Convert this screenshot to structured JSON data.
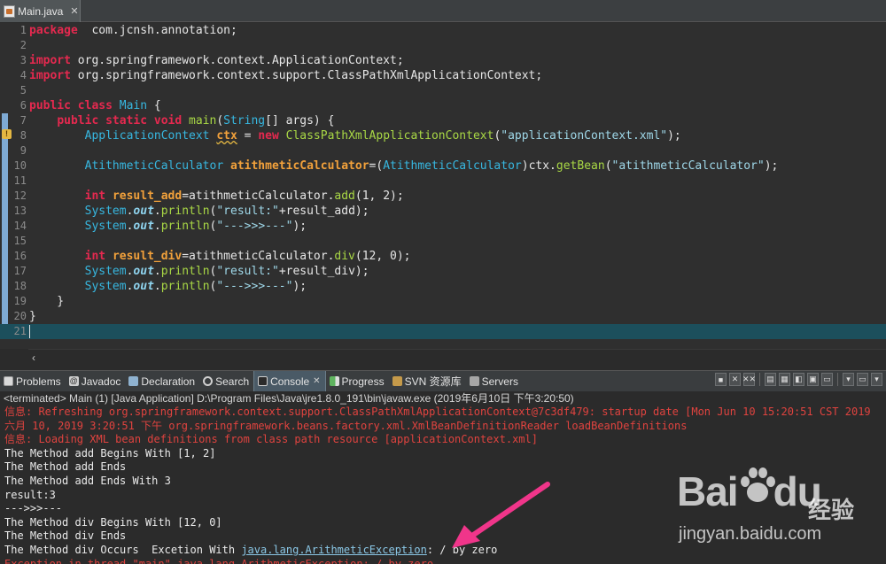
{
  "editor_tab": {
    "label": "Main.java",
    "close": "✕"
  },
  "code_lines": [
    {
      "num": "1",
      "tokens": [
        [
          "kw",
          "package"
        ],
        [
          "",
          "  com.jcnsh.annotation;"
        ]
      ]
    },
    {
      "num": "2",
      "tokens": []
    },
    {
      "num": "3",
      "tokens": [
        [
          "kw",
          "import"
        ],
        [
          "",
          " org.springframework.context.ApplicationContext;"
        ]
      ]
    },
    {
      "num": "4",
      "tokens": [
        [
          "kw",
          "import"
        ],
        [
          "",
          " org.springframework.context.support.ClassPathXmlApplicationContext;"
        ]
      ]
    },
    {
      "num": "5",
      "tokens": []
    },
    {
      "num": "6",
      "tokens": [
        [
          "kw",
          "public class"
        ],
        [
          "",
          " "
        ],
        [
          "ty",
          "Main"
        ],
        [
          "",
          " {"
        ]
      ]
    },
    {
      "num": "7",
      "tokens": [
        [
          "",
          "    "
        ],
        [
          "kw",
          "public static void"
        ],
        [
          "",
          " "
        ],
        [
          "fn",
          "main"
        ],
        [
          "",
          "("
        ],
        [
          "ty",
          "String"
        ],
        [
          "",
          "[] args) {"
        ]
      ]
    },
    {
      "num": "8",
      "tokens": [
        [
          "",
          "        "
        ],
        [
          "ty",
          "ApplicationContext"
        ],
        [
          "",
          " "
        ],
        [
          "var warn-underline",
          "ctx"
        ],
        [
          "",
          " = "
        ],
        [
          "kw",
          "new"
        ],
        [
          "",
          " "
        ],
        [
          "fn",
          "ClassPathXmlApplicationContext"
        ],
        [
          "",
          "("
        ],
        [
          "str",
          "\"applicationContext.xml\""
        ],
        [
          "",
          ");"
        ]
      ]
    },
    {
      "num": "9",
      "tokens": []
    },
    {
      "num": "10",
      "tokens": [
        [
          "",
          "        "
        ],
        [
          "ty",
          "AtithmeticCalculator"
        ],
        [
          "",
          " "
        ],
        [
          "var",
          "atithmeticCalculator"
        ],
        [
          "",
          "=("
        ],
        [
          "ty",
          "AtithmeticCalculator"
        ],
        [
          "",
          ")ctx."
        ],
        [
          "fn",
          "getBean"
        ],
        [
          "",
          "("
        ],
        [
          "str",
          "\"atithmeticCalculator\""
        ],
        [
          "",
          ");"
        ]
      ]
    },
    {
      "num": "11",
      "tokens": []
    },
    {
      "num": "12",
      "tokens": [
        [
          "",
          "        "
        ],
        [
          "kw",
          "int"
        ],
        [
          "",
          " "
        ],
        [
          "var",
          "result_add"
        ],
        [
          "",
          "=atithmeticCalculator."
        ],
        [
          "fn",
          "add"
        ],
        [
          "",
          "(1, 2);"
        ]
      ]
    },
    {
      "num": "13",
      "tokens": [
        [
          "",
          "        "
        ],
        [
          "ty",
          "System"
        ],
        [
          "",
          "."
        ],
        [
          "static",
          "out"
        ],
        [
          "",
          "."
        ],
        [
          "fn",
          "println"
        ],
        [
          "",
          "("
        ],
        [
          "str",
          "\"result:\""
        ],
        [
          "",
          "+result_add);"
        ]
      ]
    },
    {
      "num": "14",
      "tokens": [
        [
          "",
          "        "
        ],
        [
          "ty",
          "System"
        ],
        [
          "",
          "."
        ],
        [
          "static",
          "out"
        ],
        [
          "",
          "."
        ],
        [
          "fn",
          "println"
        ],
        [
          "",
          "("
        ],
        [
          "str",
          "\"--->>>---\""
        ],
        [
          "",
          ");"
        ]
      ]
    },
    {
      "num": "15",
      "tokens": []
    },
    {
      "num": "16",
      "tokens": [
        [
          "",
          "        "
        ],
        [
          "kw",
          "int"
        ],
        [
          "",
          " "
        ],
        [
          "var",
          "result_div"
        ],
        [
          "",
          "=atithmeticCalculator."
        ],
        [
          "fn",
          "div"
        ],
        [
          "",
          "(12, 0);"
        ]
      ]
    },
    {
      "num": "17",
      "tokens": [
        [
          "",
          "        "
        ],
        [
          "ty",
          "System"
        ],
        [
          "",
          "."
        ],
        [
          "static",
          "out"
        ],
        [
          "",
          "."
        ],
        [
          "fn",
          "println"
        ],
        [
          "",
          "("
        ],
        [
          "str",
          "\"result:\""
        ],
        [
          "",
          "+result_div);"
        ]
      ]
    },
    {
      "num": "18",
      "tokens": [
        [
          "",
          "        "
        ],
        [
          "ty",
          "System"
        ],
        [
          "",
          "."
        ],
        [
          "static",
          "out"
        ],
        [
          "",
          "."
        ],
        [
          "fn",
          "println"
        ],
        [
          "",
          "("
        ],
        [
          "str",
          "\"--->>>---\""
        ],
        [
          "",
          ");"
        ]
      ]
    },
    {
      "num": "19",
      "tokens": [
        [
          "",
          "    }"
        ]
      ]
    },
    {
      "num": "20",
      "tokens": [
        [
          "",
          "}"
        ]
      ]
    },
    {
      "num": "21",
      "tokens": [],
      "current": true
    }
  ],
  "view_tabs": [
    {
      "label": "Problems",
      "icon": "problems-icon",
      "cls": "ic-problems"
    },
    {
      "label": "Javadoc",
      "icon": "javadoc-icon",
      "cls": "ic-javadoc",
      "glyph": "@"
    },
    {
      "label": "Declaration",
      "icon": "declaration-icon",
      "cls": "ic-decl"
    },
    {
      "label": "Search",
      "icon": "search-icon",
      "cls": "ic-search"
    },
    {
      "label": "Console",
      "icon": "console-icon",
      "cls": "ic-console",
      "active": true,
      "close": "✕"
    },
    {
      "label": "Progress",
      "icon": "progress-icon",
      "cls": "ic-progress"
    },
    {
      "label": "SVN 资源库",
      "icon": "svn-icon",
      "cls": "ic-svn"
    },
    {
      "label": "Servers",
      "icon": "servers-icon",
      "cls": "ic-servers"
    }
  ],
  "console_toolbar": [
    "■",
    "✕",
    "✕✕",
    "▤",
    "▦",
    "◧",
    "▣",
    "▭",
    "▾",
    "▭",
    "▾"
  ],
  "console": {
    "header": "<terminated> Main (1) [Java Application] D:\\Program Files\\Java\\jre1.8.0_191\\bin\\javaw.exe (2019年6月10日 下午3:20:50)",
    "lines": [
      {
        "text": "信息: Refreshing org.springframework.context.support.ClassPathXmlApplicationContext@7c3df479: startup date [Mon Jun 10 15:20:51 CST 2019",
        "err": true
      },
      {
        "text": "六月 10, 2019 3:20:51 下午 org.springframework.beans.factory.xml.XmlBeanDefinitionReader loadBeanDefinitions",
        "err": true
      },
      {
        "text": "信息: Loading XML bean definitions from class path resource [applicationContext.xml]",
        "err": true
      },
      {
        "text": "The Method add Begins With [1, 2]"
      },
      {
        "text": "The Method add Ends"
      },
      {
        "text": "The Method add Ends With 3"
      },
      {
        "text": "result:3"
      },
      {
        "text": "--->>>---"
      },
      {
        "text": "The Method div Begins With [12, 0]"
      },
      {
        "text": "The Method div Ends"
      },
      {
        "text": "The Method div Occurs  Excetion With ",
        "link": "java.lang.ArithmeticException",
        "after": ": / by zero"
      },
      {
        "text": "Exception in thread \"main\" java.lang.ArithmeticException: / by zero",
        "err": true
      }
    ]
  },
  "watermark": {
    "logo": "Bai",
    "logo_du": "du",
    "cn": "经验",
    "url": "jingyan.baidu.com"
  },
  "colors": {
    "annotation_arrow": "#f0358a"
  }
}
